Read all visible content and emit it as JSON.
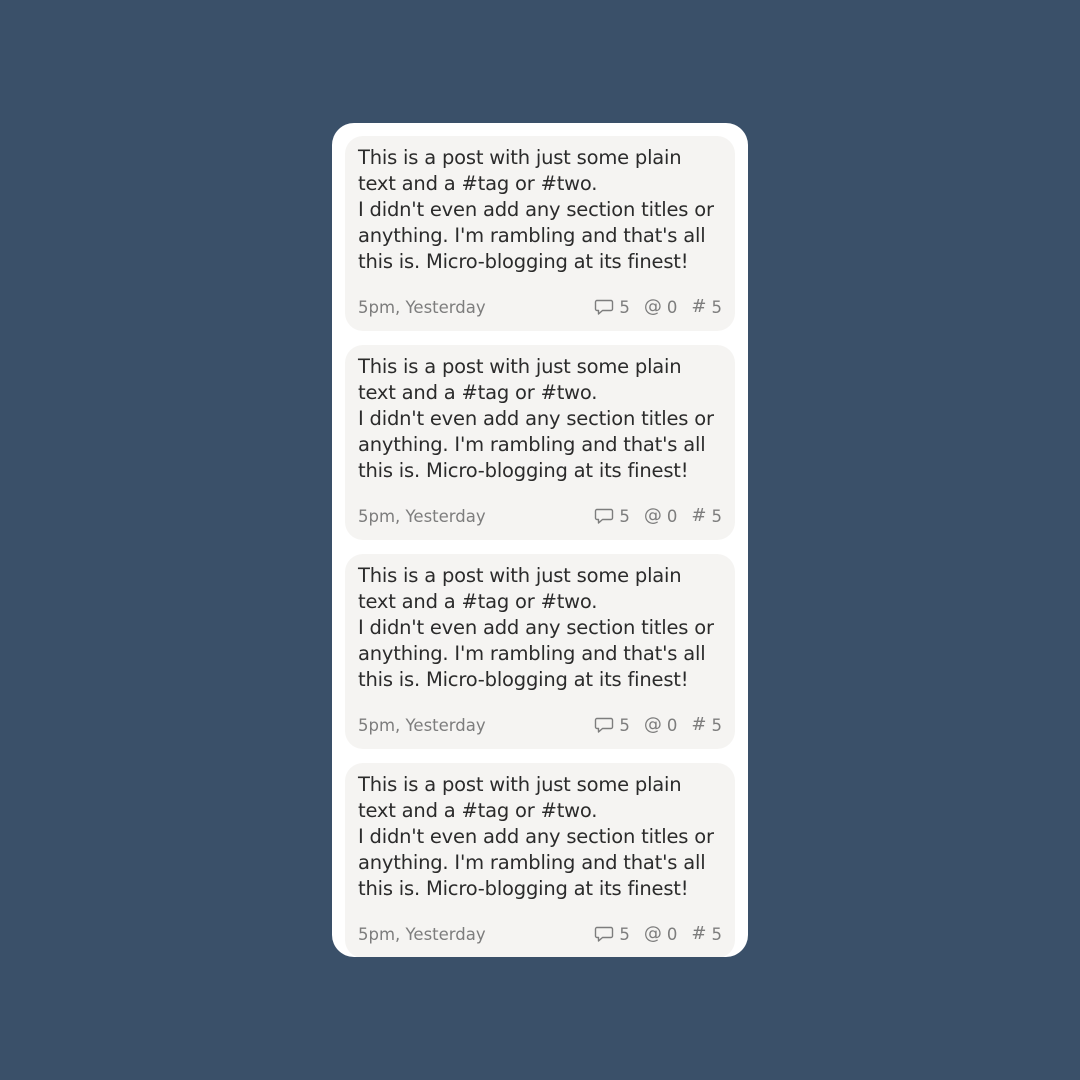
{
  "feed": {
    "posts": [
      {
        "body": {
          "line1": "This is a post with just some plain",
          "line2": "text and a #tag or #two.",
          "line3": "I didn't even add any section titles or",
          "line4": "anything. I'm rambling and that's all",
          "line5": "this is. Micro-blogging at its finest!"
        },
        "timestamp": "5pm, Yesterday",
        "comments": "5",
        "mentions": "0",
        "tags": "5"
      },
      {
        "body": {
          "line1": "This is a post with just some plain",
          "line2": "text and a #tag or #two.",
          "line3": "I didn't even add any section titles or",
          "line4": "anything. I'm rambling and that's all",
          "line5": "this is. Micro-blogging at its finest!"
        },
        "timestamp": "5pm, Yesterday",
        "comments": "5",
        "mentions": "0",
        "tags": "5"
      },
      {
        "body": {
          "line1": "This is a post with just some plain",
          "line2": "text and a #tag or #two.",
          "line3": "I didn't even add any section titles or",
          "line4": "anything. I'm rambling and that's all",
          "line5": "this is. Micro-blogging at its finest!"
        },
        "timestamp": "5pm, Yesterday",
        "comments": "5",
        "mentions": "0",
        "tags": "5"
      },
      {
        "body": {
          "line1": "This is a post with just some plain",
          "line2": "text and a #tag or #two.",
          "line3": "I didn't even add any section titles or",
          "line4": "anything. I'm rambling and that's all",
          "line5": "this is. Micro-blogging at its finest!"
        },
        "timestamp": "5pm, Yesterday",
        "comments": "5",
        "mentions": "0",
        "tags": "5"
      }
    ]
  },
  "icons": {
    "comment": "comment-icon",
    "mention": "at-sign-icon",
    "tag": "hashtag-icon",
    "mention_glyph": "@",
    "tag_glyph": "#"
  },
  "colors": {
    "background": "#3a5069",
    "panel": "#ffffff",
    "card": "#f5f4f2",
    "text": "#2b2b2b",
    "muted": "#7d7d7d"
  }
}
